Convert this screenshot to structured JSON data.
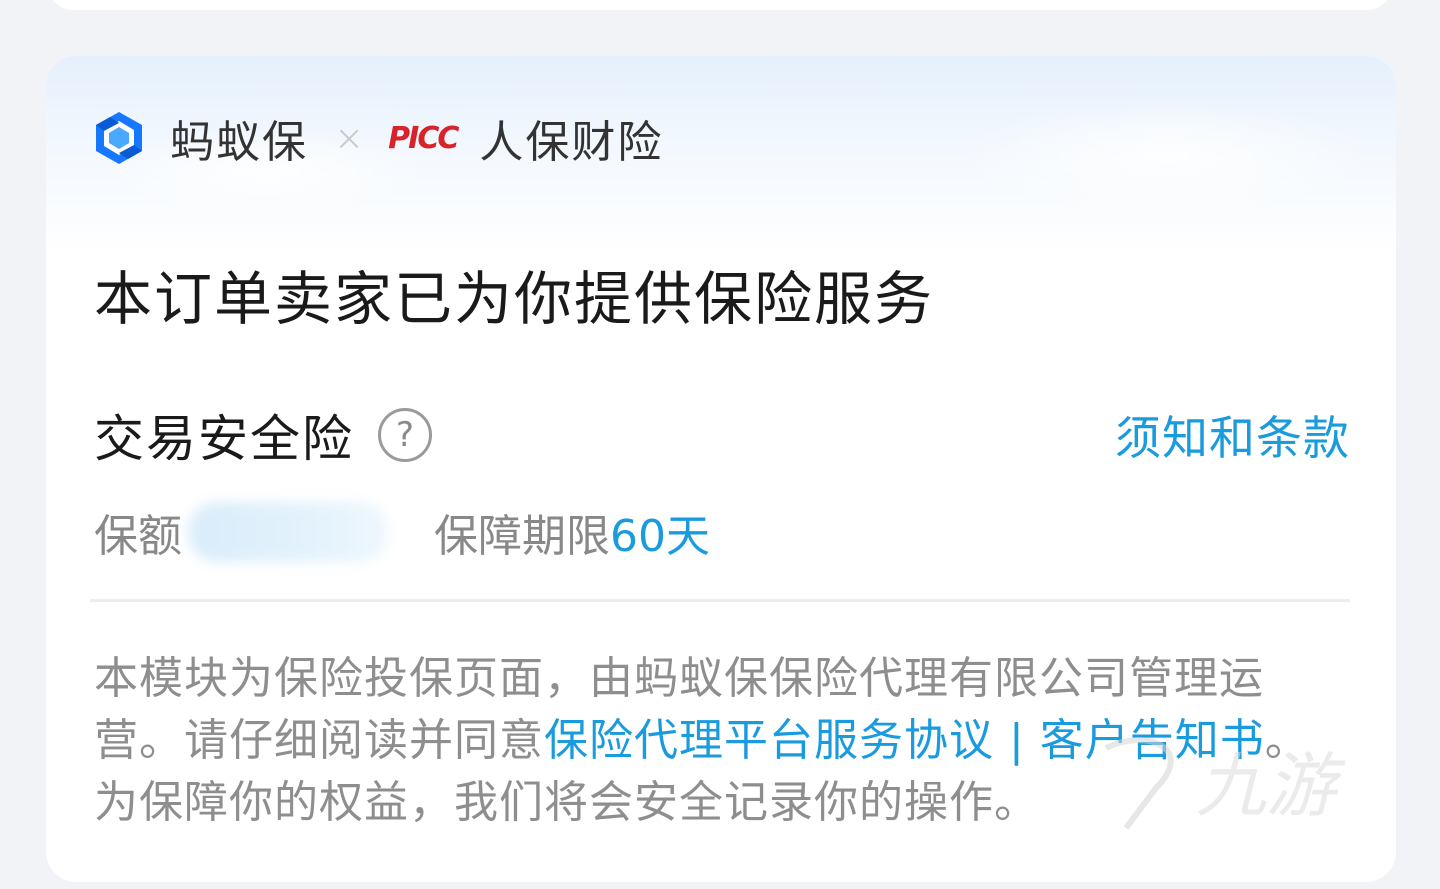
{
  "header": {
    "platform_name": "蚂蚁保",
    "separator": "×",
    "partner_logo_text": "PICC",
    "partner_name": "人保财险"
  },
  "main": {
    "title": "本订单卖家已为你提供保险服务",
    "product_name": "交易安全险",
    "help_icon_glyph": "?",
    "terms_link": "须知和条款",
    "coverage_label": "保额",
    "period_label": "保障期限",
    "period_value": "60天"
  },
  "disclaimer": {
    "text_1": "本模块为保险投保页面，由蚂蚁保保险代理有限公司管理运营。请仔细阅读并同意",
    "link_1": "保险代理平台服务协议",
    "link_separator": " | ",
    "link_2": "客户告知书",
    "text_2": "。为保障你的权益，我们将会安全记录你的操作。"
  },
  "watermark": {
    "text": "九游"
  },
  "colors": {
    "accent": "#1a9bde",
    "picc_red": "#d8232a",
    "ant_blue": "#1677ff"
  },
  "icons": {
    "platform_logo": "ant-insurance-logo-icon",
    "help": "question-circle-icon"
  }
}
